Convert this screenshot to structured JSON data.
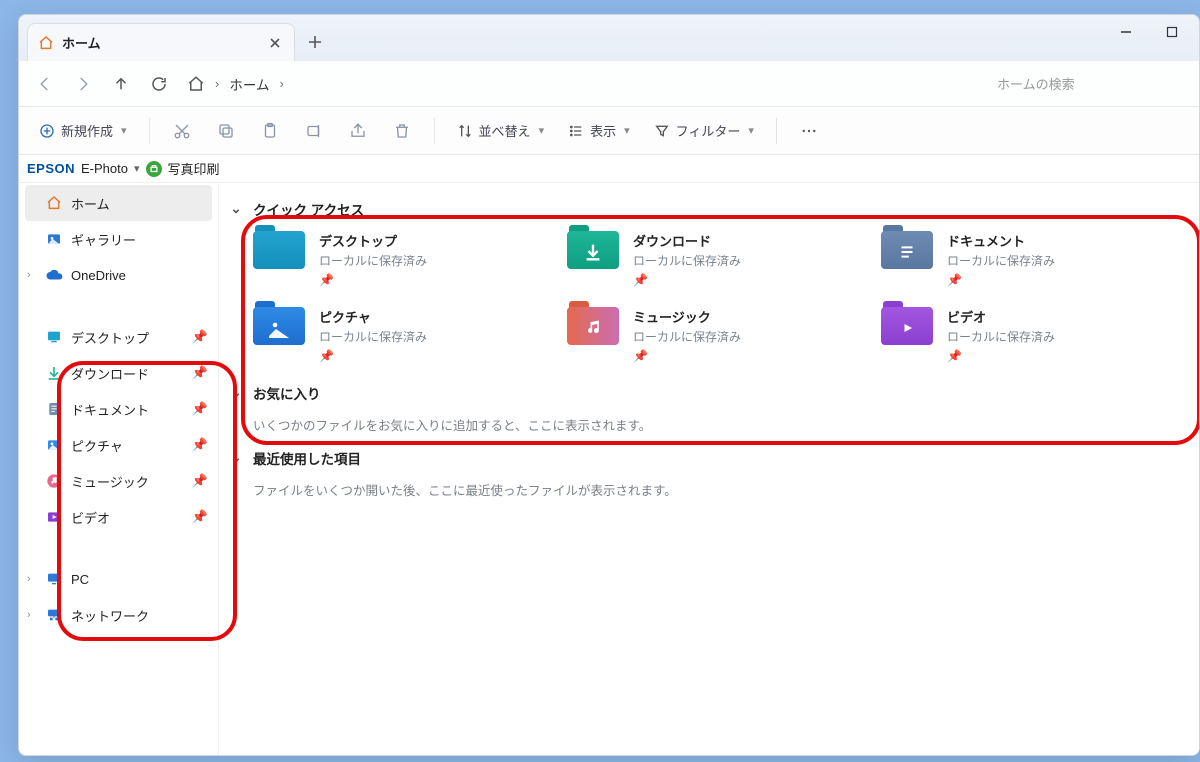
{
  "window": {
    "tab_title": "ホーム",
    "tab_close": "×",
    "new_tab": "＋"
  },
  "nav": {
    "breadcrumb_home_label": "ホーム",
    "search_placeholder": "ホームの検索"
  },
  "toolbar": {
    "new_label": "新規作成",
    "sort_label": "並べ替え",
    "view_label": "表示",
    "filter_label": "フィルター"
  },
  "epson": {
    "brand": "EPSON",
    "product": "E-Photo",
    "print_label": "写真印刷"
  },
  "sidebar": {
    "home": "ホーム",
    "gallery": "ギャラリー",
    "onedrive": "OneDrive",
    "desktop": "デスクトップ",
    "downloads": "ダウンロード",
    "documents": "ドキュメント",
    "pictures": "ピクチャ",
    "music": "ミュージック",
    "videos": "ビデオ",
    "pc": "PC",
    "network": "ネットワーク"
  },
  "content": {
    "quick_access_header": "クイック アクセス",
    "favorites_header": "お気に入り",
    "favorites_desc": "いくつかのファイルをお気に入りに追加すると、ここに表示されます。",
    "recent_header": "最近使用した項目",
    "recent_desc": "ファイルをいくつか開いた後、ここに最近使ったファイルが表示されます。",
    "saved_local": "ローカルに保存済み",
    "items": {
      "desktop": "デスクトップ",
      "downloads": "ダウンロード",
      "documents": "ドキュメント",
      "pictures": "ピクチャ",
      "music": "ミュージック",
      "videos": "ビデオ"
    }
  },
  "colors": {
    "desktop": [
      "#22a3cf",
      "#1490bb"
    ],
    "downloads": [
      "#1fb697",
      "#0f9e82"
    ],
    "documents": [
      "#6d8bb3",
      "#5a789f"
    ],
    "pictures": [
      "#2f8be6",
      "#1e6ecf"
    ],
    "music": [
      "#e46b4e",
      "#cb6db3"
    ],
    "videos": [
      "#a356e0",
      "#8b3fd0"
    ]
  }
}
